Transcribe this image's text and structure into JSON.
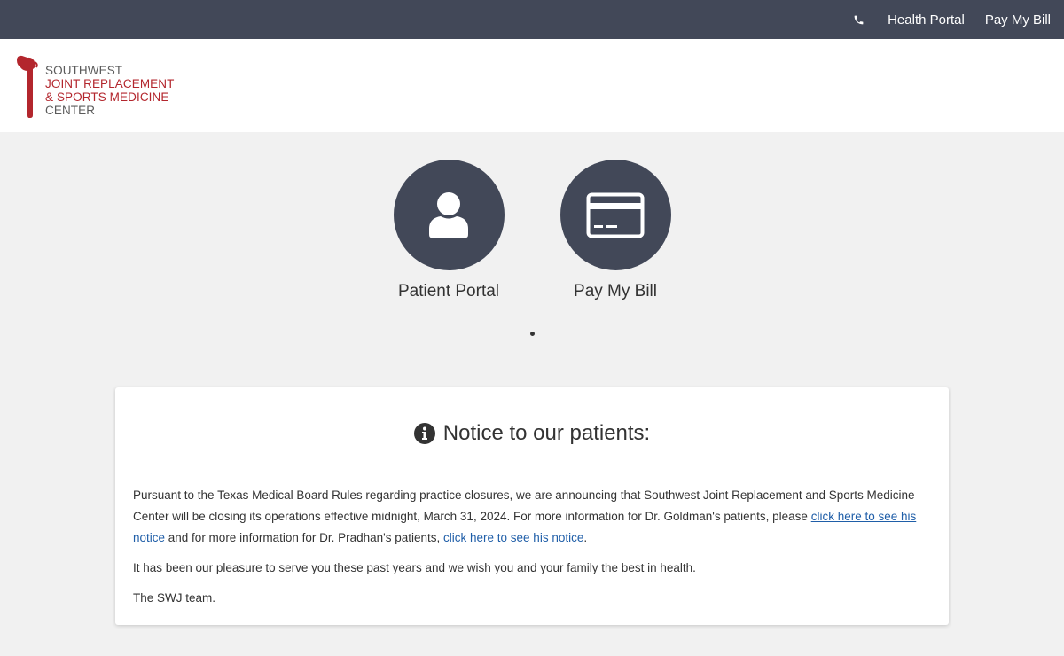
{
  "topbar": {
    "phone_icon": "phone-icon",
    "links": [
      "Health Portal",
      "Pay My Bill"
    ]
  },
  "logo": {
    "line1": "SOUTHWEST",
    "line2": "JOINT REPLACEMENT",
    "line3": "& SPORTS MEDICINE",
    "line4": "CENTER",
    "colors": {
      "gray": "#5b5b5b",
      "red": "#b3262d"
    }
  },
  "actions": [
    {
      "label": "Patient Portal",
      "icon": "user-icon"
    },
    {
      "label": "Pay My Bill",
      "icon": "credit-card-icon"
    }
  ],
  "notice": {
    "icon": "info-icon",
    "title": "Notice to our patients:",
    "p1_text1": "Pursuant to the Texas Medical Board Rules regarding practice closures, we are announcing that Southwest Joint Replacement and Sports Medicine Center will be closing its operations effective midnight, March 31, 2024. For more information for Dr. Goldman's patients, please ",
    "p1_link1": "click here to see his notice",
    "p1_text2": " and for more information for Dr. Pradhan's patients, ",
    "p1_link2": "click here to see his notice",
    "p1_text3": ".",
    "p2": "It has been our pleasure to serve you these past years and we wish you and your family the best in health.",
    "p3": "The SWJ team."
  },
  "colors": {
    "topbar": "#424858",
    "circle": "#424858",
    "link": "#1f5ea8",
    "background": "#f1f1f1"
  }
}
